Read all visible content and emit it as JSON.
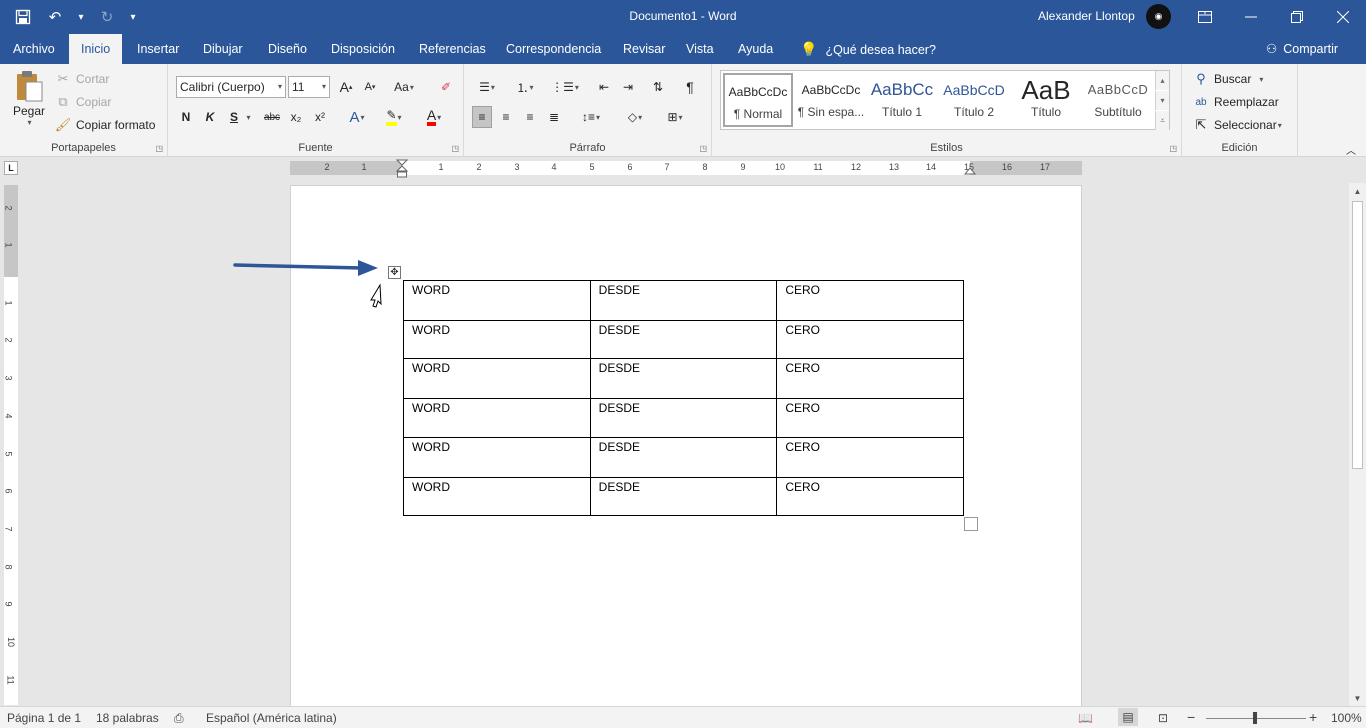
{
  "window": {
    "document_title": "Documento1  -  Word",
    "user_name": "Alexander Llontop"
  },
  "tabs": [
    "Archivo",
    "Inicio",
    "Insertar",
    "Dibujar",
    "Diseño",
    "Disposición",
    "Referencias",
    "Correspondencia",
    "Revisar",
    "Vista",
    "Ayuda"
  ],
  "active_tab": "Inicio",
  "tell_me": "¿Qué desea hacer?",
  "share_label": "Compartir",
  "ribbon": {
    "clipboard": {
      "label": "Portapapeles",
      "paste": "Pegar",
      "cut": "Cortar",
      "copy": "Copiar",
      "format_painter": "Copiar formato"
    },
    "font": {
      "label": "Fuente",
      "font_name": "Calibri (Cuerpo)",
      "font_size": "11",
      "grow": "A",
      "shrink": "A",
      "case": "Aa",
      "bold": "N",
      "italic": "K",
      "underline": "S",
      "strike": "abc",
      "subscript": "x₂",
      "superscript": "x²",
      "effects": "A",
      "font_color": "A"
    },
    "paragraph": {
      "label": "Párrafo"
    },
    "styles": {
      "label": "Estilos",
      "items": [
        {
          "preview": "AaBbCcDc",
          "name": "¶ Normal"
        },
        {
          "preview": "AaBbCcDc",
          "name": "¶ Sin espa..."
        },
        {
          "preview": "AaBbCc",
          "name": "Título 1"
        },
        {
          "preview": "AaBbCcD",
          "name": "Título 2"
        },
        {
          "preview": "AaB",
          "name": "Título"
        },
        {
          "preview": "AaBbCcD",
          "name": "Subtítulo"
        }
      ]
    },
    "editing": {
      "label": "Edición",
      "find": "Buscar",
      "replace": "Reemplazar",
      "select": "Seleccionar"
    }
  },
  "ruler": {
    "horizontal_ticks": [
      "2",
      "1",
      "1",
      "2",
      "3",
      "4",
      "5",
      "6",
      "7",
      "8",
      "9",
      "10",
      "11",
      "12",
      "13",
      "14",
      "15",
      "16",
      "17"
    ],
    "vertical_ticks": [
      "2",
      "1",
      "1",
      "2",
      "3",
      "4",
      "5",
      "6",
      "7",
      "8",
      "9",
      "10",
      "11",
      "12",
      "13"
    ]
  },
  "table": {
    "rows": [
      [
        "WORD",
        "DESDE",
        "CERO"
      ],
      [
        "WORD",
        "DESDE",
        "CERO"
      ],
      [
        "WORD",
        "DESDE",
        "CERO"
      ],
      [
        "WORD",
        "DESDE",
        "CERO"
      ],
      [
        "WORD",
        "DESDE",
        "CERO"
      ],
      [
        "WORD",
        "DESDE",
        "CERO"
      ]
    ]
  },
  "status": {
    "page": "Página 1 de 1",
    "words": "18 palabras",
    "language": "Español (América latina)",
    "zoom": "100%"
  },
  "colors": {
    "accent": "#2b579a",
    "arrow": "#2e5597",
    "highlight": "#ffff00",
    "font_color": "#ff0000"
  }
}
